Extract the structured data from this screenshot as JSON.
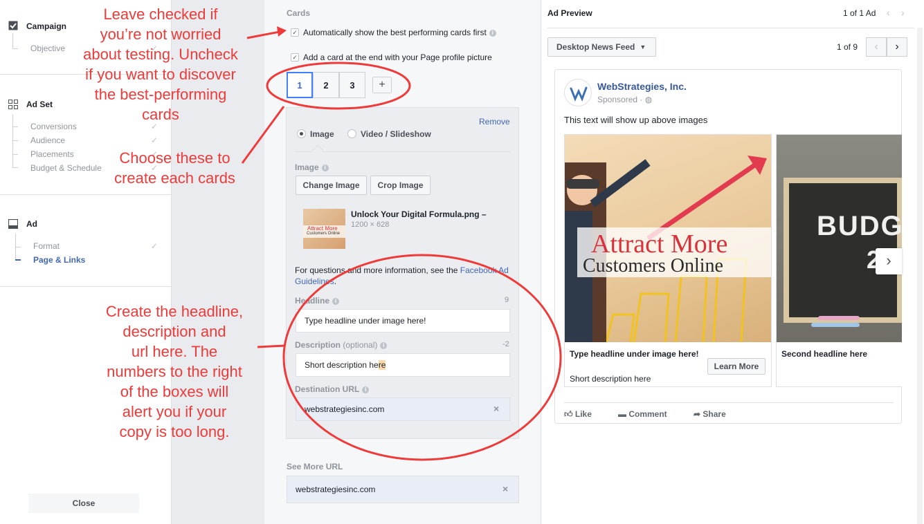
{
  "sidebar": {
    "campaign": {
      "title": "Campaign",
      "items": [
        "Objective"
      ]
    },
    "adset": {
      "title": "Ad Set",
      "items": [
        "Conversions",
        "Audience",
        "Placements",
        "Budget & Schedule"
      ]
    },
    "ad": {
      "title": "Ad",
      "items": [
        "Format",
        "Page & Links"
      ]
    },
    "close_label": "Close"
  },
  "editor": {
    "cards_label": "Cards",
    "auto_show_label": "Automatically show the best performing cards first",
    "add_card_label": "Add a card at the end with your Page profile picture",
    "card_tabs": [
      "1",
      "2",
      "3"
    ],
    "add_tab": "+",
    "remove_label": "Remove",
    "media_image": "Image",
    "media_video": "Video / Slideshow",
    "image_label": "Image",
    "change_image": "Change Image",
    "crop_image": "Crop Image",
    "file_name": "Unlock Your Digital Formula.png –",
    "file_size": "1200 × 628",
    "thumb_text_1": "Attract More",
    "thumb_text_2": "Customers Online",
    "help_text": "For questions and more information, see the ",
    "help_link": "Facebook Ad Guidelines",
    "help_end": ".",
    "headline_label": "Headline",
    "headline_count": "9",
    "headline_value": "Type headline under image here!",
    "description_label": "Description",
    "description_optional": "(optional)",
    "description_count": "-2",
    "description_value_a": "Short description he",
    "description_value_b": "re",
    "destination_label": "Destination URL",
    "destination_value": "webstrategiesinc.com",
    "see_more_label": "See More URL",
    "see_more_value": "webstrategiesinc.com",
    "clear_icon": "×"
  },
  "annotations": {
    "leave_checked": [
      "Leave checked if",
      "you’re not worried",
      "about testing. Uncheck",
      "if you want to discover",
      "the best-performing",
      "cards"
    ],
    "choose_cards": [
      "Choose these to",
      "create each cards"
    ],
    "create_headline": [
      "Create the headline,",
      "description and",
      "url here. The",
      "numbers to the right",
      "of the boxes will",
      "alert you if your",
      "copy is too long."
    ]
  },
  "preview": {
    "title": "Ad Preview",
    "ad_pager": "1 of 1 Ad",
    "placement": "Desktop News Feed",
    "card_pager": "1 of 9",
    "page_name": "WebStrategies, Inc.",
    "sponsored": "Sponsored ·",
    "post_text": "This text will show up above images",
    "card1": {
      "image_line1": "Attract More",
      "image_line2": "Customers Online",
      "headline": "Type headline under image here!",
      "description": "Short description here",
      "cta": "Learn More"
    },
    "card2": {
      "image_text": "BUDG",
      "image_text2": "2",
      "headline": "Second headline here"
    },
    "actions": [
      "Like",
      "Comment",
      "Share"
    ]
  },
  "colors": {
    "annotation_red": "#ef3a3a",
    "link_blue": "#4267b2",
    "accent_blue": "#4080ff"
  }
}
